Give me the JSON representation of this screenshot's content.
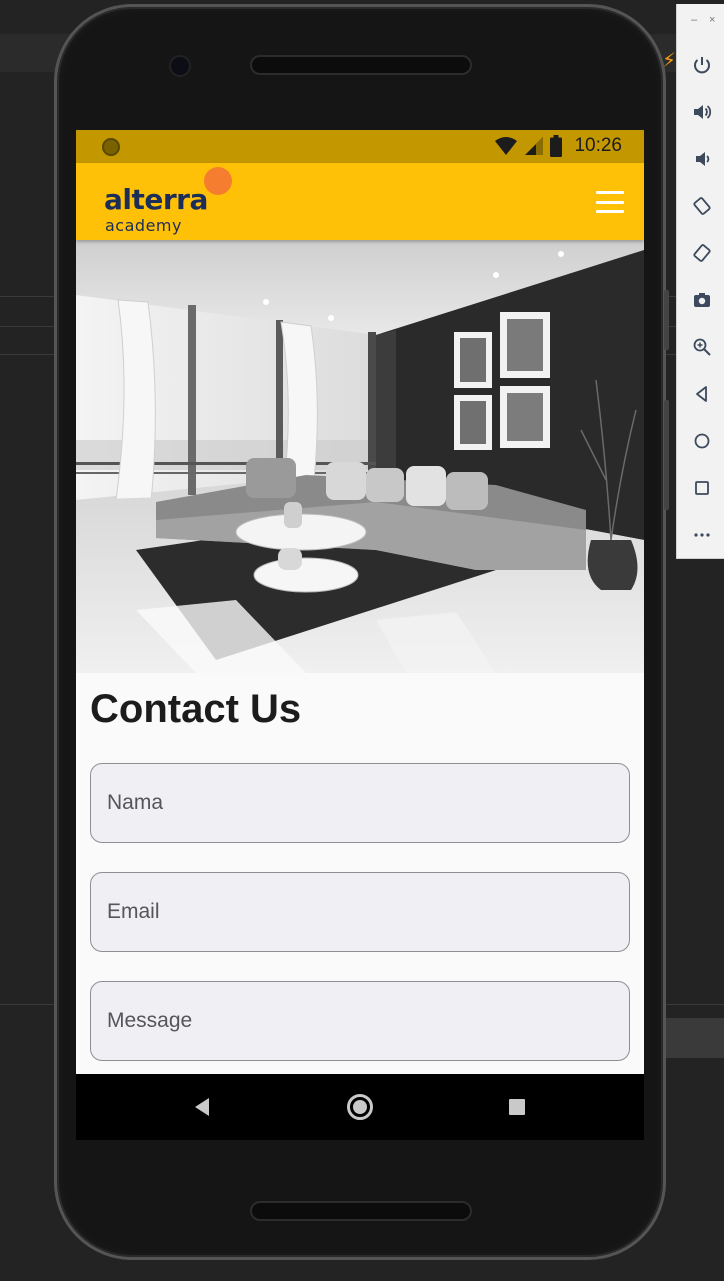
{
  "status_bar": {
    "time": "10:26"
  },
  "app_bar": {
    "logo_main": "alterra",
    "logo_sub": "academy",
    "menu_icon": "hamburger-menu-icon"
  },
  "hero": {
    "description": "living-room-photo"
  },
  "contact": {
    "title": "Contact Us",
    "fields": {
      "name_placeholder": "Nama",
      "email_placeholder": "Email",
      "message_placeholder": "Message"
    }
  },
  "nav_bar": {
    "back_icon": "back-icon",
    "home_icon": "home-icon",
    "recents_icon": "recents-icon"
  },
  "emulator_toolbar": {
    "window_controls": [
      "–",
      "×"
    ],
    "tools": [
      "power-icon",
      "volume-up-icon",
      "volume-down-icon",
      "rotate-left-icon",
      "rotate-right-icon",
      "camera-icon",
      "zoom-icon",
      "back-icon",
      "home-icon",
      "overview-icon",
      "more-icon"
    ]
  },
  "colors": {
    "app_bar": "#ffc107",
    "status_bar": "#c29700",
    "logo_text": "#1d2d5a",
    "logo_dot": "#f47d30",
    "field_bg": "#efeff4"
  }
}
